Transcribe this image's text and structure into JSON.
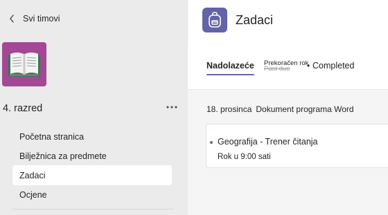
{
  "sidebar": {
    "back_label": "Svi timovi",
    "team_name": "4. razred",
    "nav_items": [
      {
        "label": "Početna stranica",
        "active": false
      },
      {
        "label": "Bilježnica za predmete",
        "active": false
      },
      {
        "label": "Zadaci",
        "active": true
      },
      {
        "label": "Ocjene",
        "active": false
      }
    ]
  },
  "header": {
    "title": "Zadaci",
    "icon": "backpack-icon"
  },
  "tabs": {
    "upcoming": "Nadolazeće",
    "overdue_small": "Prekoračen rok",
    "overdue_strike": "Past due",
    "separator": "•",
    "completed": "Completed"
  },
  "section": {
    "date": "18. prosinca",
    "doc": "Dokument programa Word"
  },
  "assignment": {
    "title": "Geografija - Trener čitanja",
    "due": "Rok u 9:00 sati"
  },
  "colors": {
    "accent": "#6264a7",
    "team_avatar": "#a44896",
    "sidebar_bg": "#ebebeb"
  }
}
